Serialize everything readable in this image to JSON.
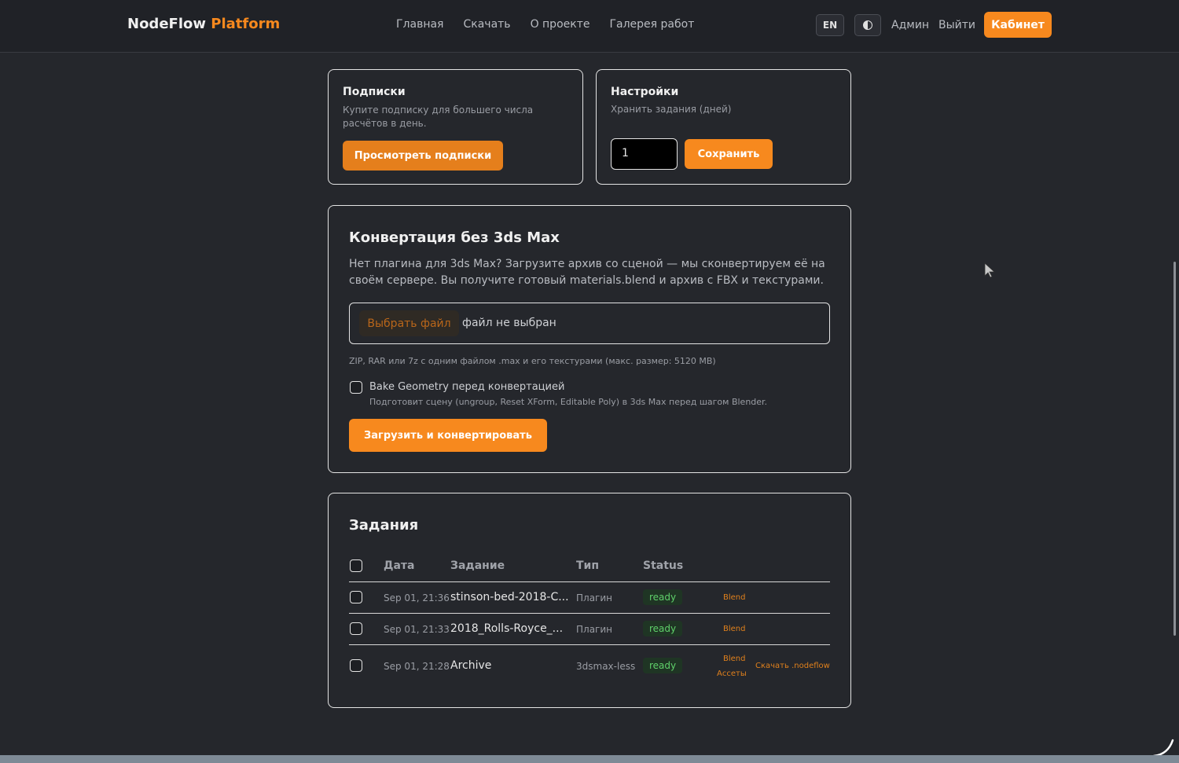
{
  "header": {
    "brand_main": "NodeFlow",
    "brand_accent": "Platform",
    "nav": [
      "Главная",
      "Скачать",
      "О проекте",
      "Галерея работ"
    ],
    "lang": "EN",
    "admin": "Админ",
    "logout": "Выйти",
    "cabinet": "Кабинет"
  },
  "subscriptions": {
    "title": "Подписки",
    "description": "Купите подписку для большего числа расчётов в день.",
    "button": "Просмотреть подписки"
  },
  "settings": {
    "title": "Настройки",
    "label": "Хранить задания (дней)",
    "value": "1",
    "save": "Сохранить"
  },
  "convert": {
    "title": "Конвертация без 3ds Max",
    "description": "Нет плагина для 3ds Max? Загрузите архив со сценой — мы сконвертируем её на своём сервере. Вы получите готовый materials.blend и архив с FBX и текстурами.",
    "file_button": "Выбрать файл",
    "file_none": "файл не выбран",
    "hint": "ZIP, RAR или 7z с одним файлом .max и его текстурами (макс. размер: 5120 MB)",
    "bake_label": "Bake Geometry перед конвертацией",
    "bake_hint": "Подготовит сцену (ungroup, Reset XForm, Editable Poly) в 3ds Max перед шагом Blender.",
    "submit": "Загрузить и конвертировать"
  },
  "jobs": {
    "title": "Задания",
    "columns": [
      "Дата",
      "Задание",
      "Тип",
      "Status"
    ],
    "rows": [
      {
        "date": "Sep 01, 21:36",
        "name": "stinson-bed-2018-C...",
        "type": "Плагин",
        "status": "ready",
        "links": [
          "Blend"
        ]
      },
      {
        "date": "Sep 01, 21:33",
        "name": "2018_Rolls-Royce_...",
        "type": "Плагин",
        "status": "ready",
        "links": [
          "Blend"
        ]
      },
      {
        "date": "Sep 01, 21:28",
        "name": "Archive",
        "type": "3dsmax-less",
        "status": "ready",
        "links": [
          "Blend",
          "Ассеты",
          "Скачать .nodeflow"
        ]
      }
    ]
  },
  "colors": {
    "accent": "#f7891e",
    "background": "#25272c",
    "status_ready": "#5fd06a"
  }
}
